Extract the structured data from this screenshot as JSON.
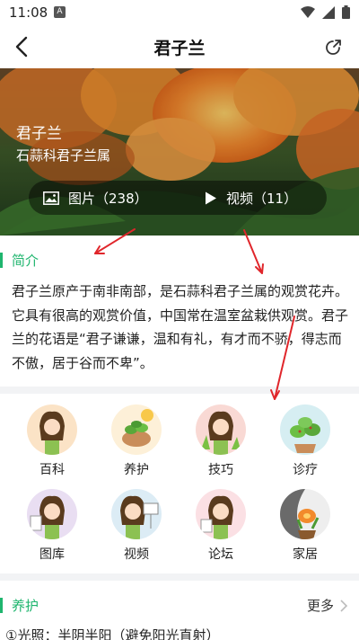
{
  "status_bar": {
    "time": "11:08",
    "notif_letter": "A"
  },
  "nav": {
    "title": "君子兰"
  },
  "hero": {
    "name": "君子兰",
    "family": "石蒜科君子兰属",
    "pictures_label": "图片（238）",
    "videos_label": "视频（11）"
  },
  "intro": {
    "heading": "简介",
    "text": "君子兰原产于南非南部，是石蒜科君子兰属的观赏花卉。它具有很高的观赏价值，中国常在温室盆栽供观赏。君子兰的花语是“君子谦谦，温和有礼，有才而不骄，得志而不傲，居于谷而不卑”。"
  },
  "grid": {
    "items": [
      {
        "label": "百科",
        "icon": "encyclopedia-avatar-icon",
        "color": "#fbe3c6"
      },
      {
        "label": "养护",
        "icon": "care-plant-icon",
        "color": "#fdf0d8"
      },
      {
        "label": "技巧",
        "icon": "tips-avatar-icon",
        "color": "#f9d9d4"
      },
      {
        "label": "诊疗",
        "icon": "diagnosis-plant-icon",
        "color": "#d6eef2"
      },
      {
        "label": "图库",
        "icon": "gallery-avatar-icon",
        "color": "#e9def2"
      },
      {
        "label": "视频",
        "icon": "video-avatar-icon",
        "color": "#dcecf5"
      },
      {
        "label": "论坛",
        "icon": "forum-avatar-icon",
        "color": "#fbe0e4"
      },
      {
        "label": "家居",
        "icon": "home-decor-icon",
        "color": "#eeeeee"
      }
    ]
  },
  "care": {
    "heading": "养护",
    "more_label": "更多",
    "first_line": "①光照：半阴半阳（避免阳光直射）"
  },
  "colors": {
    "accent": "#1fb56e",
    "annotation_arrow": "#e0262b"
  }
}
